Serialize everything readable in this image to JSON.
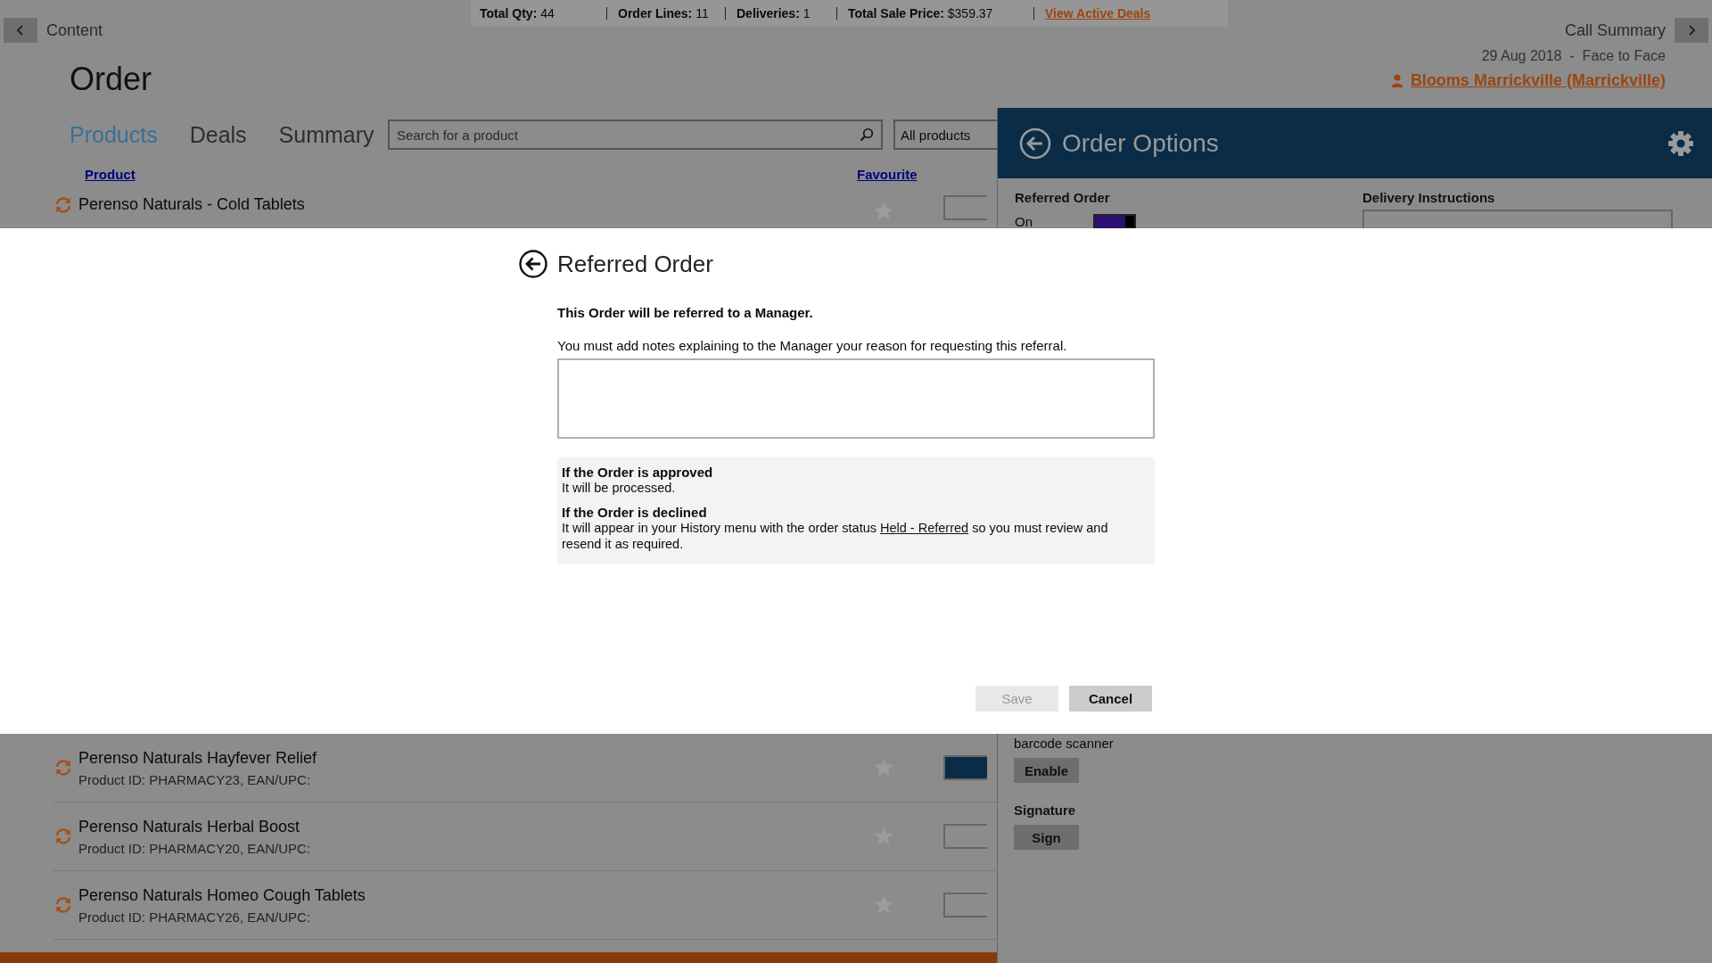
{
  "nav": {
    "back_label": "Content",
    "forward_label": "Call Summary"
  },
  "summary_bar": [
    {
      "label": "Total Qty:",
      "value": "44"
    },
    {
      "label": "Order Lines:",
      "value": "11"
    },
    {
      "label": "Deliveries:",
      "value": "1"
    },
    {
      "label": "Total Sale Price:",
      "value": "$359.37"
    }
  ],
  "deals_link": "View Active Deals",
  "page_title": "Order",
  "visit": {
    "line": "29 Aug 2018  -  Face to Face",
    "customer": "Blooms Marrickville (Marrickville)"
  },
  "tabs": [
    {
      "label": "Products",
      "selected": true
    },
    {
      "label": "Deals",
      "selected": false
    },
    {
      "label": "Summary",
      "selected": false
    }
  ],
  "search": {
    "placeholder": "Search for a product"
  },
  "filter": {
    "value": "All products"
  },
  "columns": [
    "Product",
    "Favourite"
  ],
  "products_top": [
    {
      "name": "Perenso Naturals - Cold Tablets",
      "favourite": false,
      "in_order": false
    }
  ],
  "products_bottom": [
    {
      "name": "Perenso Naturals Hayfever Relief",
      "product_id": "Product ID: PHARMACY23, EAN/UPC:",
      "favourite": false,
      "in_order": true
    },
    {
      "name": "Perenso Naturals Herbal Boost",
      "product_id": "Product ID: PHARMACY20, EAN/UPC:",
      "favourite": false,
      "in_order": false
    },
    {
      "name": "Perenso Naturals Homeo Cough Tablets",
      "product_id": "Product ID: PHARMACY26, EAN/UPC:",
      "favourite": false,
      "in_order": false
    }
  ],
  "order_options": {
    "title": "Order Options",
    "referred": {
      "label": "Referred Order",
      "state_text": "On",
      "on": true
    },
    "delivery_label": "Delivery Instructions",
    "scanner_label": "barcode scanner",
    "scanner_button": "Enable",
    "signature_label": "Signature",
    "signature_button": "Sign"
  },
  "dialog": {
    "title": "Referred Order",
    "lead": "This Order will be referred to a Manager.",
    "instruction": "You must add notes explaining to the Manager your reason for requesting this referral.",
    "outcomes": [
      {
        "heading": "If the Order is approved",
        "text": "It will be processed."
      },
      {
        "heading": "If the Order is declined",
        "text": "It will appear in your History menu with the order status",
        "link": "Held - Referred",
        "text_after": "so you must review and resend it as required."
      }
    ],
    "buttons": [
      {
        "label": "Save",
        "disabled": true
      },
      {
        "label": "Cancel",
        "disabled": false
      }
    ]
  }
}
